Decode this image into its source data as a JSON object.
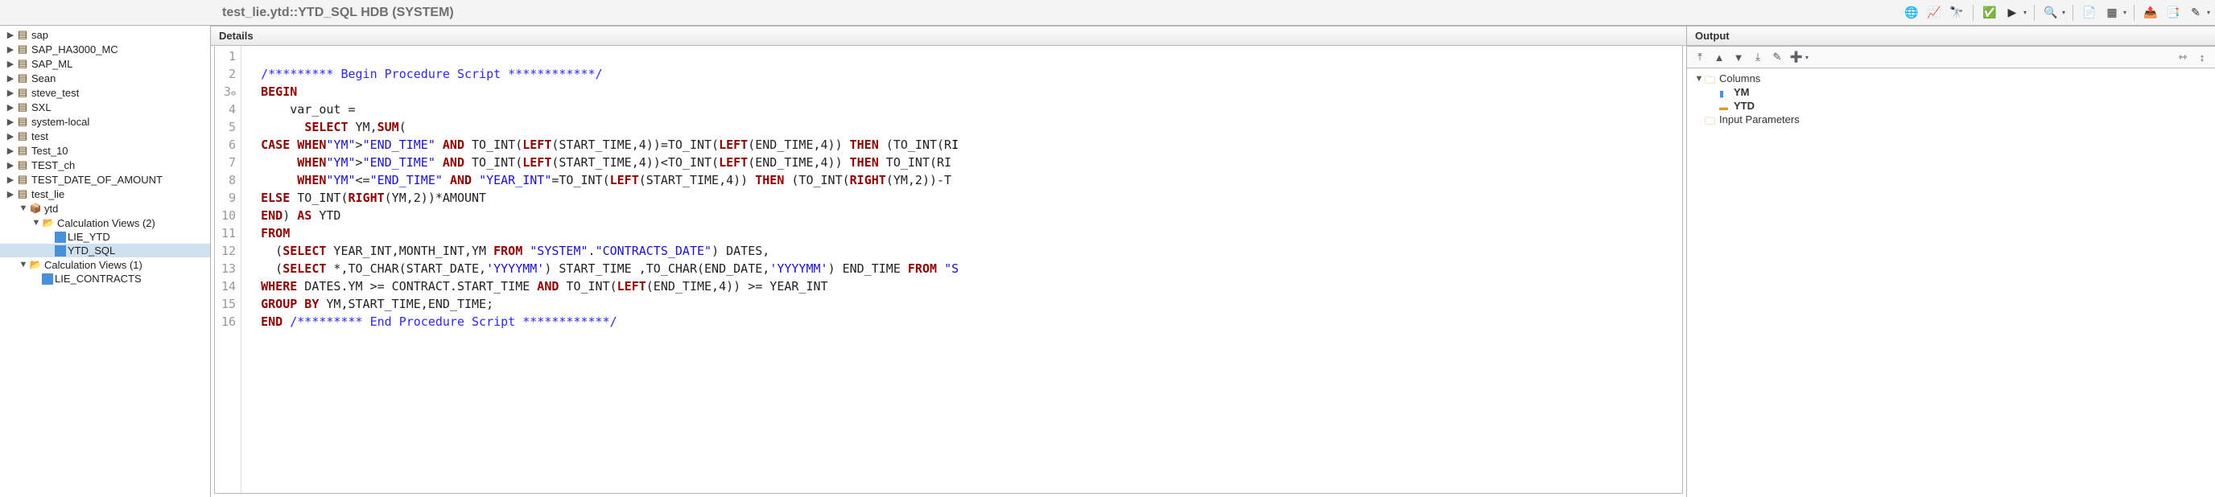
{
  "title_bar": {
    "title": "test_lie.ytd::YTD_SQL HDB (SYSTEM)"
  },
  "toolbar_icons": [
    "globe-icon",
    "chart-icon",
    "binoculars-icon",
    "check-icon",
    "play-icon",
    "inspect-icon",
    "document-icon",
    "grid-icon",
    "export-icon",
    "copy-icon",
    "edit-icon"
  ],
  "tree": [
    {
      "indent": 0,
      "expand": "▶",
      "icon": "schema",
      "label": "sap"
    },
    {
      "indent": 0,
      "expand": "▶",
      "icon": "schema",
      "label": "SAP_HA3000_MC"
    },
    {
      "indent": 0,
      "expand": "▶",
      "icon": "schema",
      "label": "SAP_ML"
    },
    {
      "indent": 0,
      "expand": "▶",
      "icon": "schema",
      "label": "Sean"
    },
    {
      "indent": 0,
      "expand": "▶",
      "icon": "schema",
      "label": "steve_test"
    },
    {
      "indent": 0,
      "expand": "▶",
      "icon": "schema",
      "label": "SXL"
    },
    {
      "indent": 0,
      "expand": "▶",
      "icon": "schema",
      "label": "system-local"
    },
    {
      "indent": 0,
      "expand": "▶",
      "icon": "schema",
      "label": "test"
    },
    {
      "indent": 0,
      "expand": "▶",
      "icon": "schema",
      "label": "Test_10"
    },
    {
      "indent": 0,
      "expand": "▶",
      "icon": "schema",
      "label": "TEST_ch"
    },
    {
      "indent": 0,
      "expand": "▶",
      "icon": "schema",
      "label": "TEST_DATE_OF_AMOUNT"
    },
    {
      "indent": 0,
      "expand": "▶",
      "icon": "schema",
      "label": "test_lie"
    },
    {
      "indent": 1,
      "expand": "▼",
      "icon": "pkg",
      "label": "ytd"
    },
    {
      "indent": 2,
      "expand": "▼",
      "icon": "folder-open",
      "label": "Calculation Views (2)"
    },
    {
      "indent": 3,
      "expand": "",
      "icon": "cv",
      "label": "LIE_YTD"
    },
    {
      "indent": 3,
      "expand": "",
      "icon": "cv",
      "label": "YTD_SQL",
      "selected": true
    },
    {
      "indent": 1,
      "expand": "▼",
      "icon": "folder-open",
      "label": "Calculation Views (1)"
    },
    {
      "indent": 2,
      "expand": "",
      "icon": "cv",
      "label": "LIE_CONTRACTS"
    }
  ],
  "details_header": "Details",
  "code_lines": [
    {
      "n": "1",
      "fold": "",
      "html": ""
    },
    {
      "n": "2",
      "fold": "",
      "html": "  <span class=cm>/********* Begin Procedure Script ************/</span>"
    },
    {
      "n": "3",
      "fold": "⊖",
      "html": "  <span class=kwred>BEGIN</span>"
    },
    {
      "n": "4",
      "fold": "",
      "html": "      var_out ="
    },
    {
      "n": "5",
      "fold": "",
      "html": "        <span class=kwred>SELECT</span> YM,<span class=kwred>SUM</span>("
    },
    {
      "n": "6",
      "fold": "",
      "html": "  <span class=kwred>CASE</span> <span class=kwred>WHEN</span><span class=st>\"YM\"</span>&gt;<span class=st>\"END_TIME\"</span> <span class=kwred>AND</span> TO_INT(<span class=kwred>LEFT</span>(START_TIME,4))=TO_INT(<span class=kwred>LEFT</span>(END_TIME,4)) <span class=kwred>THEN</span> (TO_INT(R<span class=id>I</span>"
    },
    {
      "n": "7",
      "fold": "",
      "html": "       <span class=kwred>WHEN</span><span class=st>\"YM\"</span>&gt;<span class=st>\"END_TIME\"</span> <span class=kwred>AND</span> TO_INT(<span class=kwred>LEFT</span>(START_TIME,4))&lt;TO_INT(<span class=kwred>LEFT</span>(END_TIME,4)) <span class=kwred>THEN</span> TO_INT(RI<span class=id></span>"
    },
    {
      "n": "8",
      "fold": "",
      "html": "       <span class=kwred>WHEN</span><span class=st>\"YM\"</span>&lt;=<span class=st>\"END_TIME\"</span> <span class=kwred>AND</span> <span class=st>\"YEAR_INT\"</span>=TO_INT(<span class=kwred>LEFT</span>(START_TIME,4)) <span class=kwred>THEN</span> (TO_INT(<span class=kwred>RIGHT</span>(YM,2))-T<span class=id></span>"
    },
    {
      "n": "9",
      "fold": "",
      "html": "  <span class=kwred>ELSE</span> TO_INT(<span class=kwred>RIGHT</span>(YM,2))*AMOUNT"
    },
    {
      "n": "10",
      "fold": "",
      "html": "  <span class=kwred>END</span>) <span class=kwred>AS</span> YTD"
    },
    {
      "n": "11",
      "fold": "",
      "html": "  <span class=kwred>FROM</span>"
    },
    {
      "n": "12",
      "fold": "",
      "html": "    (<span class=kwred>SELECT</span> YEAR_INT,MONTH_INT,YM <span class=kwred>FROM</span> <span class=st>\"SYSTEM\"</span>.<span class=st>\"CONTRACTS_DATE\"</span>) DATES,"
    },
    {
      "n": "13",
      "fold": "",
      "html": "    (<span class=kwred>SELECT</span> *,TO_CHAR(START_DATE,<span class=st>'YYYYMM'</span>) START_TIME ,TO_CHAR(END_DATE,<span class=st>'YYYYMM'</span>) END_TIME <span class=kwred>FROM</span> <span class=st>\"S</span>"
    },
    {
      "n": "14",
      "fold": "",
      "html": "  <span class=kwred>WHERE</span> DATES.YM &gt;= CONTRACT.START_TIME <span class=kwred>AND</span> TO_INT(<span class=kwred>LEFT</span>(END_TIME,4)) &gt;= YEAR_INT"
    },
    {
      "n": "15",
      "fold": "",
      "html": "  <span class=kwred>GROUP BY</span> YM,START_TIME,END_TIME;"
    },
    {
      "n": "16",
      "fold": "",
      "html": "  <span class=kwred>END</span> <span class=cm>/********* End Procedure Script ************/</span>"
    }
  ],
  "output": {
    "header": "Output",
    "toolbar_icons": [
      "collapse-all-icon",
      "up-icon",
      "down-icon",
      "collapse-icon",
      "edit-icon",
      "add-icon",
      "expand-h-icon",
      "expand-v-icon"
    ],
    "tree": [
      {
        "indent": 0,
        "expand": "▼",
        "icon": "folder",
        "label": "Columns",
        "bold": false
      },
      {
        "indent": 1,
        "expand": "",
        "icon": "col-blue",
        "label": "YM",
        "bold": true
      },
      {
        "indent": 1,
        "expand": "",
        "icon": "col-yellow",
        "label": "YTD",
        "bold": true
      },
      {
        "indent": 0,
        "expand": "",
        "icon": "folder",
        "label": "Input Parameters",
        "bold": false
      }
    ]
  }
}
